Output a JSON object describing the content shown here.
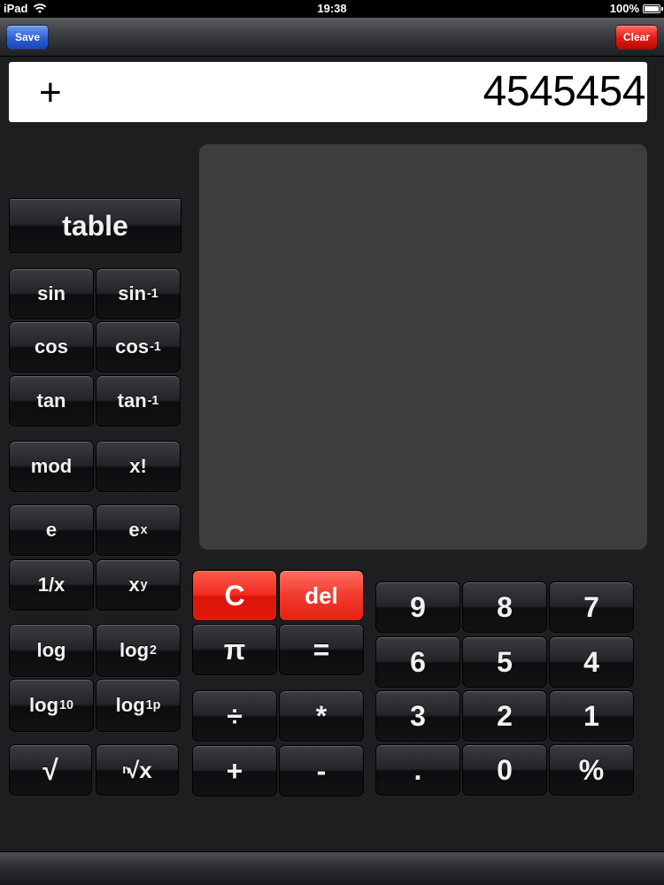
{
  "status": {
    "device": "iPad",
    "time": "19:38",
    "battery": "100%"
  },
  "toolbar": {
    "save_label": "Save",
    "clear_label": "Clear"
  },
  "display": {
    "operator": "+",
    "value": "4545454"
  },
  "sci_keys": {
    "table": "table",
    "sin": "sin",
    "asin_base": "sin",
    "asin_sup": "-1",
    "cos": "cos",
    "acos_base": "cos",
    "acos_sup": "-1",
    "tan": "tan",
    "atan_base": "tan",
    "atan_sup": "-1",
    "mod": "mod",
    "fact": "x!",
    "e": "e",
    "exp_base": "e",
    "exp_sup": "x",
    "recip": "1/x",
    "pow_base": "x",
    "pow_sup": "y",
    "log": "log",
    "log2_base": "log",
    "log2_sub": "2",
    "log10_base": "log",
    "log10_sub": "10",
    "log1p_base": "log",
    "log1p_sub": "1p",
    "sqrt": "√",
    "nroot_n": "n",
    "nroot_rad": "√",
    "nroot_x": "x"
  },
  "ops": {
    "c": "C",
    "del": "del",
    "pi": "π",
    "equals": "=",
    "divide": "÷",
    "multiply": "*",
    "plus": "+",
    "minus": "-"
  },
  "digits": {
    "d9": "9",
    "d8": "8",
    "d7": "7",
    "d6": "6",
    "d5": "5",
    "d4": "4",
    "d3": "3",
    "d2": "2",
    "d1": "1",
    "dot": ".",
    "d0": "0",
    "percent": "%"
  },
  "colors": {
    "save": "#2c5fd6",
    "clear": "#e21a12",
    "clear_key": "#f02b20",
    "panel": "#3c3d3f",
    "background": "#1d1e20"
  }
}
